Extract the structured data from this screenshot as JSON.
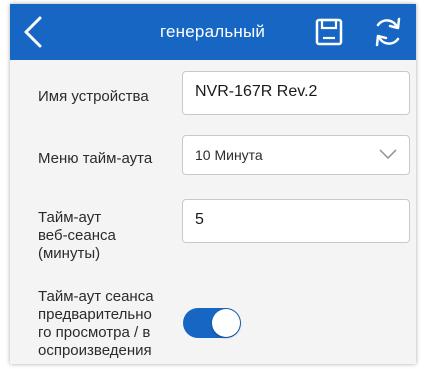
{
  "header": {
    "title": "генеральный",
    "background": "#1766c4",
    "back_icon": "chevron-left-icon",
    "save_icon": "floppy-disk-icon",
    "refresh_icon": "refresh-icon"
  },
  "settings": {
    "device_name": {
      "label": "Имя устройства",
      "value": "NVR-167R Rev.2"
    },
    "timeout_menu": {
      "label": "Меню тайм-аута",
      "value": "10 Минута"
    },
    "web_session_timeout": {
      "label_lines": [
        "Тайм-аут",
        "веб-сеанса",
        "(минуты)"
      ],
      "value": "5"
    },
    "preview_playback_timeout": {
      "label_lines": [
        "Тайм-аут сеанса",
        "предварительно",
        "го просмотра / в",
        "оспроизведения"
      ],
      "enabled": true
    }
  }
}
